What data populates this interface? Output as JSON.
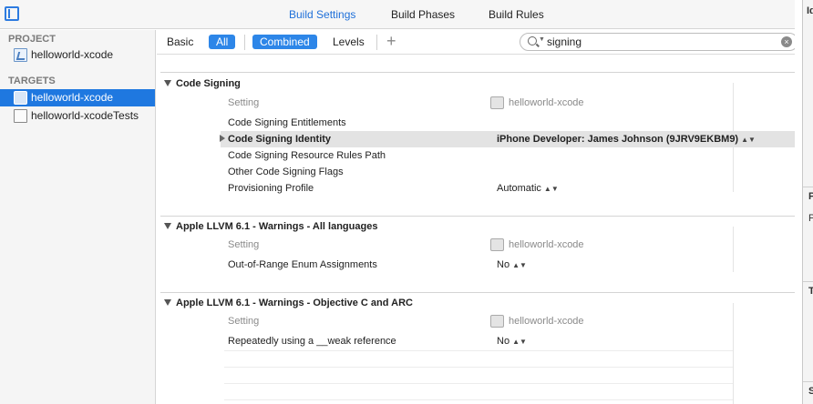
{
  "toolbar": {
    "tabs": [
      "Build Settings",
      "Build Phases",
      "Build Rules"
    ]
  },
  "sidebar": {
    "project_header": "PROJECT",
    "project_item": "helloworld-xcode",
    "targets_header": "TARGETS",
    "targets": [
      "helloworld-xcode",
      "helloworld-xcodeTests"
    ]
  },
  "filter": {
    "basic": "Basic",
    "all": "All",
    "combined": "Combined",
    "levels": "Levels",
    "plus": "+",
    "search_value": "signing",
    "clear": "×"
  },
  "sections": [
    {
      "title": "Code Signing",
      "header_setting": "Setting",
      "header_target": "helloworld-xcode",
      "rows": [
        {
          "label": "Code Signing Entitlements",
          "value": ""
        },
        {
          "label": "Code Signing Identity",
          "value": "iPhone Developer: James Johnson (9JRV9EKBM9)"
        },
        {
          "label": "Code Signing Resource Rules Path",
          "value": ""
        },
        {
          "label": "Other Code Signing Flags",
          "value": ""
        },
        {
          "label": "Provisioning Profile",
          "value": "Automatic"
        }
      ]
    },
    {
      "title": "Apple LLVM 6.1 - Warnings - All languages",
      "header_setting": "Setting",
      "header_target": "helloworld-xcode",
      "rows": [
        {
          "label": "Out-of-Range Enum Assignments",
          "value": "No"
        }
      ]
    },
    {
      "title": "Apple LLVM 6.1 - Warnings - Objective C and ARC",
      "header_setting": "Setting",
      "header_target": "helloworld-xcode",
      "rows": [
        {
          "label": "Repeatedly using a __weak reference",
          "value": "No"
        }
      ]
    }
  ],
  "inspector": {
    "letters": [
      "Id",
      "P",
      "P",
      "T",
      "S"
    ]
  },
  "colors": {
    "accent": "#1f78e0",
    "pill": "#2d86e8",
    "highlight_row": "#e3e3e3"
  }
}
